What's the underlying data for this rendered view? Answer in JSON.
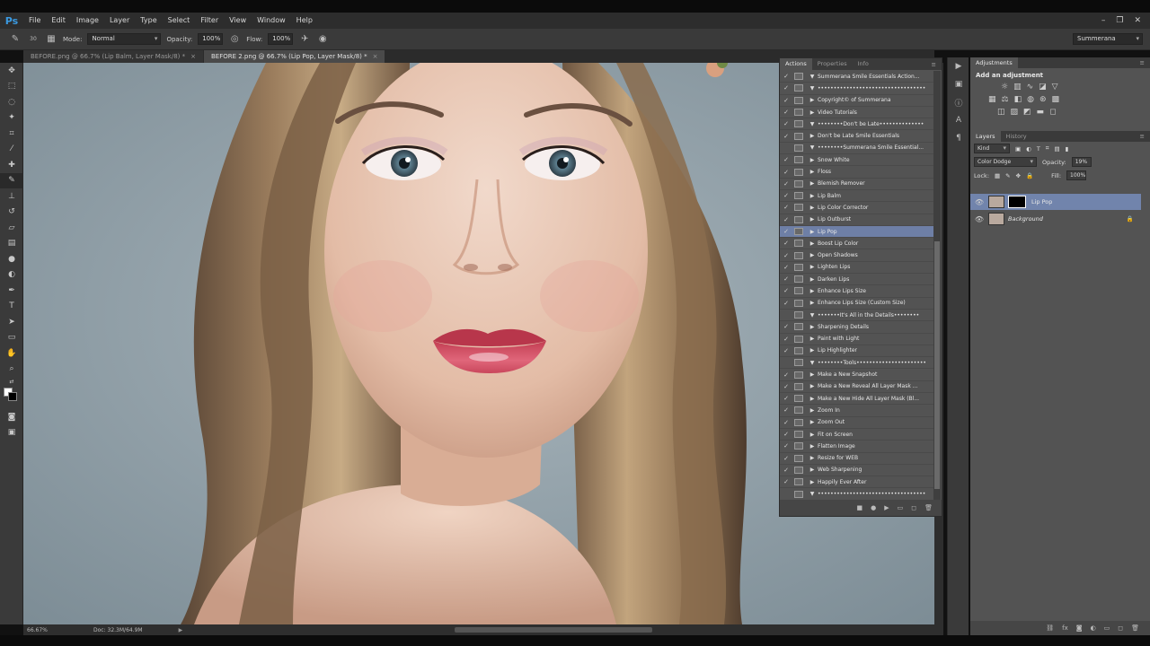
{
  "app": {
    "logo": "Ps"
  },
  "menu": [
    "File",
    "Edit",
    "Image",
    "Layer",
    "Type",
    "Select",
    "Filter",
    "View",
    "Window",
    "Help"
  ],
  "window_controls": {
    "minimize": "–",
    "restore": "❐",
    "close": "✕"
  },
  "options_bar": {
    "brush_size": "30",
    "mode_label": "Mode:",
    "mode_value": "Normal",
    "opacity_label": "Opacity:",
    "opacity_value": "100%",
    "flow_label": "Flow:",
    "flow_value": "100%",
    "workspace": "Summerana"
  },
  "tabs": [
    {
      "label": "BEFORE.png @ 66.7% (Lip Balm, Layer Mask/8) *",
      "active": false
    },
    {
      "label": "BEFORE 2.png @ 66.7% (Lip Pop, Layer Mask/8) *",
      "active": true
    }
  ],
  "status": {
    "zoom": "66.67%",
    "doc": "Doc: 32.3M/64.9M"
  },
  "actions_panel": {
    "tabs": [
      "Actions",
      "Properties",
      "Info"
    ],
    "items": [
      {
        "label": "Summerana Smile Essentials Action...",
        "check": "✓",
        "expand": "▼",
        "selected": false
      },
      {
        "label": "••••••••••••••••••••••••••••••••••",
        "check": "✓",
        "expand": "▼",
        "selected": false
      },
      {
        "label": "Copyright© of Summerana",
        "check": "✓",
        "expand": "▶",
        "selected": false
      },
      {
        "label": "Video Tutorials",
        "check": "✓",
        "expand": "▶",
        "selected": false
      },
      {
        "label": "••••••••Don't be Late••••••••••••••",
        "check": "✓",
        "expand": "▼",
        "selected": false
      },
      {
        "label": "Don't be Late Smile Essentials",
        "check": "✓",
        "expand": "▶",
        "selected": false
      },
      {
        "label": "••••••••Summerana Smile Essential...",
        "check": "",
        "expand": "▼",
        "selected": false
      },
      {
        "label": "Snow White",
        "check": "✓",
        "expand": "▶",
        "selected": false
      },
      {
        "label": "Floss",
        "check": "✓",
        "expand": "▶",
        "selected": false
      },
      {
        "label": "Blemish Remover",
        "check": "✓",
        "expand": "▶",
        "selected": false
      },
      {
        "label": "Lip Balm",
        "check": "✓",
        "expand": "▶",
        "selected": false
      },
      {
        "label": "Lip Color Corrector",
        "check": "✓",
        "expand": "▶",
        "selected": false
      },
      {
        "label": "Lip Outburst",
        "check": "✓",
        "expand": "▶",
        "selected": false
      },
      {
        "label": "Lip Pop",
        "check": "✓",
        "expand": "▶",
        "selected": true
      },
      {
        "label": "Boost Lip Color",
        "check": "✓",
        "expand": "▶",
        "selected": false
      },
      {
        "label": "Open Shadows",
        "check": "✓",
        "expand": "▶",
        "selected": false
      },
      {
        "label": "Lighten Lips",
        "check": "✓",
        "expand": "▶",
        "selected": false
      },
      {
        "label": "Darken Lips",
        "check": "✓",
        "expand": "▶",
        "selected": false
      },
      {
        "label": "Enhance Lips Size",
        "check": "✓",
        "expand": "▶",
        "selected": false
      },
      {
        "label": "Enhance Lips Size (Custom Size)",
        "check": "✓",
        "expand": "▶",
        "selected": false
      },
      {
        "label": "•••••••It's All in the Details••••••••",
        "check": "",
        "expand": "▼",
        "selected": false
      },
      {
        "label": "Sharpening Details",
        "check": "✓",
        "expand": "▶",
        "selected": false
      },
      {
        "label": "Paint with Light",
        "check": "✓",
        "expand": "▶",
        "selected": false
      },
      {
        "label": "Lip Highlighter",
        "check": "✓",
        "expand": "▶",
        "selected": false
      },
      {
        "label": "••••••••Tools••••••••••••••••••••••",
        "check": "",
        "expand": "▼",
        "selected": false
      },
      {
        "label": "Make a New Snapshot",
        "check": "✓",
        "expand": "▶",
        "selected": false
      },
      {
        "label": "Make a New Reveal All Layer Mask ...",
        "check": "✓",
        "expand": "▶",
        "selected": false
      },
      {
        "label": "Make a New Hide All Layer Mask (Bl...",
        "check": "✓",
        "expand": "▶",
        "selected": false
      },
      {
        "label": "Zoom In",
        "check": "✓",
        "expand": "▶",
        "selected": false
      },
      {
        "label": "Zoom Out",
        "check": "✓",
        "expand": "▶",
        "selected": false
      },
      {
        "label": "Fit on Screen",
        "check": "✓",
        "expand": "▶",
        "selected": false
      },
      {
        "label": "Flatten Image",
        "check": "✓",
        "expand": "▶",
        "selected": false
      },
      {
        "label": "Resize for WEB",
        "check": "✓",
        "expand": "▶",
        "selected": false
      },
      {
        "label": "Web Sharpening",
        "check": "✓",
        "expand": "▶",
        "selected": false
      },
      {
        "label": "Happily Ever After",
        "check": "✓",
        "expand": "▶",
        "selected": false
      },
      {
        "label": "••••••••••••••••••••••••••••••••••",
        "check": "",
        "expand": "▼",
        "selected": false
      }
    ]
  },
  "adjustments_panel": {
    "tab": "Adjustments",
    "title": "Add an adjustment"
  },
  "layers_panel": {
    "tabs": [
      "Layers",
      "History"
    ],
    "kind": "Kind",
    "blend_mode": "Color Dodge",
    "opacity_label": "Opacity:",
    "opacity_value": "19%",
    "lock_label": "Lock:",
    "fill_label": "Fill:",
    "fill_value": "100%",
    "layers": [
      {
        "name": "Lip Pop",
        "selected": true,
        "has_mask": true,
        "locked": false
      },
      {
        "name": "Background",
        "selected": false,
        "has_mask": false,
        "locked": true
      }
    ]
  }
}
